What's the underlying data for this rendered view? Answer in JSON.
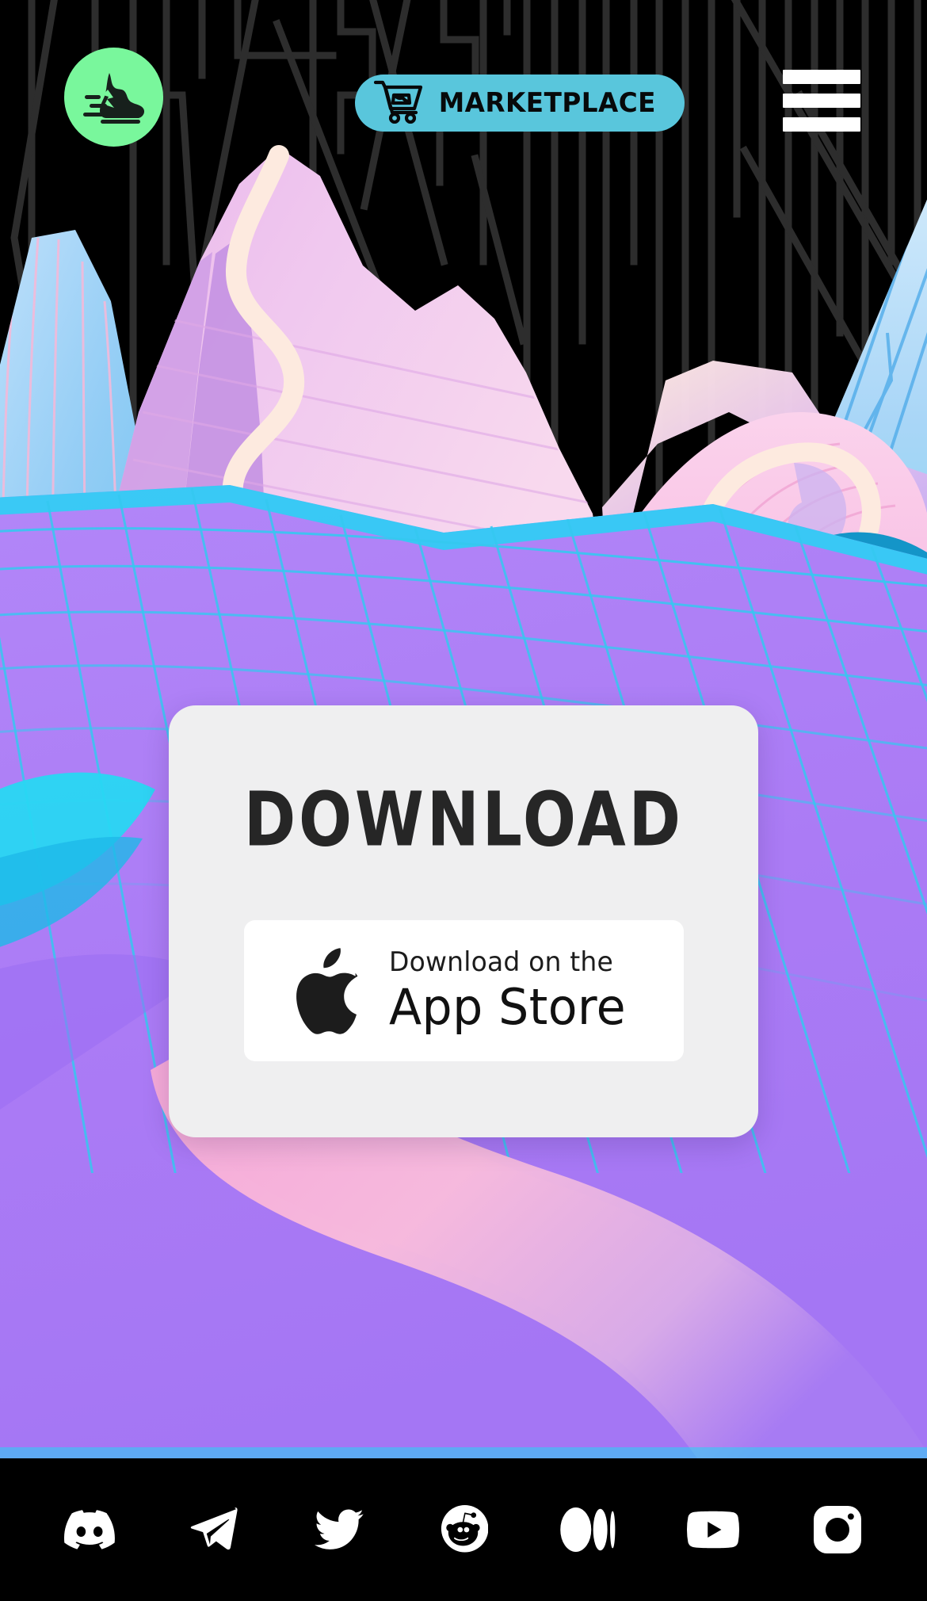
{
  "header": {
    "logo": {
      "icon": "sneaker-logo-icon",
      "circle_color": "#79f79c",
      "glyph_color": "#17201c"
    },
    "marketplace_button": {
      "label": "MARKETPLACE",
      "icon": "shopping-cart-with-shoe-icon",
      "bg_color": "#59c6dc",
      "text_color": "#07090a"
    },
    "menu_button": {
      "icon": "hamburger-menu-icon",
      "bar_color": "#ffffff",
      "bars": 3
    }
  },
  "card": {
    "title": "DOWNLOAD",
    "bg_color": "#efeff0",
    "title_color": "#262626",
    "app_store_button": {
      "icon": "apple-logo-icon",
      "line1": "Download on the",
      "line2": "App Store",
      "bg_color": "#ffffff",
      "text_color": "#111111"
    }
  },
  "footer": {
    "bg_color": "#000000",
    "icon_color": "#ffffff",
    "social_links": [
      {
        "name": "discord",
        "icon": "discord-icon",
        "label": "Discord"
      },
      {
        "name": "telegram",
        "icon": "telegram-icon",
        "label": "Telegram"
      },
      {
        "name": "twitter",
        "icon": "twitter-icon",
        "label": "Twitter"
      },
      {
        "name": "reddit",
        "icon": "reddit-icon",
        "label": "Reddit"
      },
      {
        "name": "medium",
        "icon": "medium-icon",
        "label": "Medium"
      },
      {
        "name": "youtube",
        "icon": "youtube-icon",
        "label": "YouTube"
      },
      {
        "name": "instagram",
        "icon": "instagram-icon",
        "label": "Instagram"
      }
    ]
  },
  "illustration": {
    "name": "pastel-vaporwave-mountain-landscape",
    "sky_color": "#000000",
    "sky_line_color": "#2d2d2d",
    "palette": {
      "mountain_pink": "#eec0ec",
      "mountain_pink_light": "#f6d7f3",
      "mountain_violet": "#c99ae4",
      "path_cream": "#fdeadf",
      "peak_blue": "#a8d4f7",
      "peak_ice": "#bdeaf7",
      "teal": "#35c2bd",
      "deep_blue": "#1495c8",
      "plain_purple": "#ab7bf5",
      "plain_purple_light": "#b98cf8",
      "grid_cyan": "#35c8f0",
      "river_pink": "#f3a8d6",
      "cyan_strip": "#25d5f5"
    }
  }
}
